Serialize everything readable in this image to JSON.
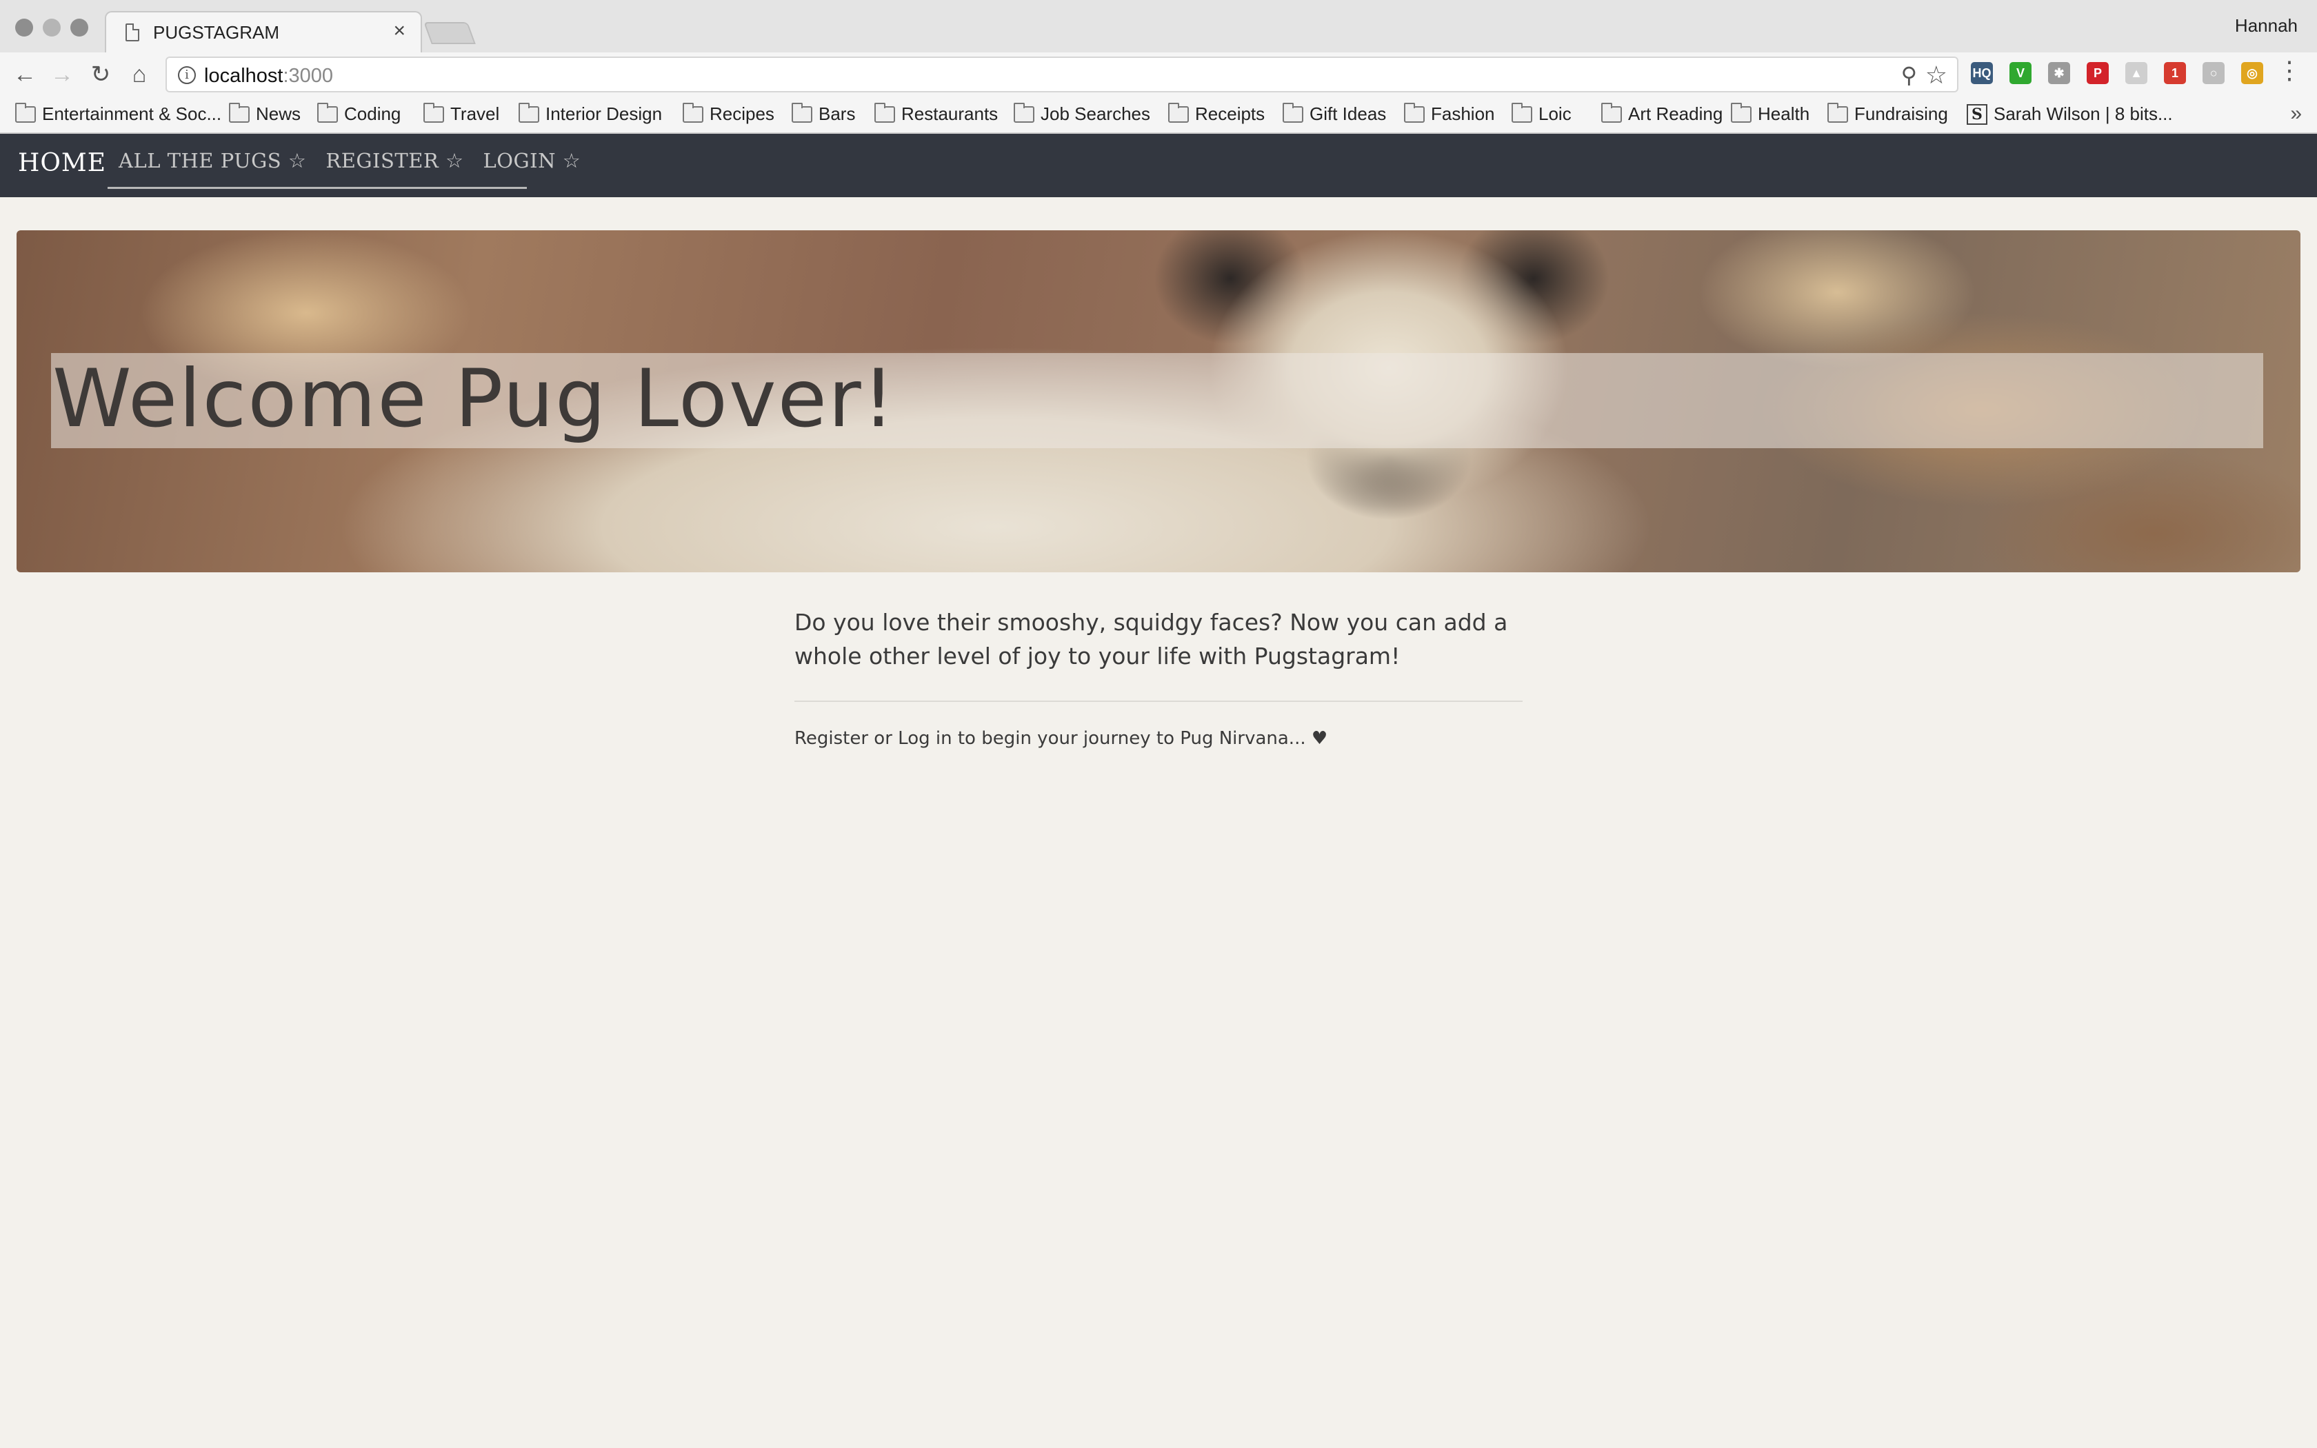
{
  "browser": {
    "tab_title": "PUGSTAGRAM",
    "tab_close": "×",
    "profile_name": "Hannah",
    "url_host": "localhost",
    "url_port": ":3000",
    "icons": {
      "back": "←",
      "forward": "→",
      "reload": "↻",
      "home": "⌂",
      "info": "i",
      "zoom": "⚲",
      "star": "☆",
      "menu": "⋮",
      "more": "»"
    },
    "extensions": [
      {
        "name": "cloudhq-extension-icon",
        "label": "HQ",
        "color": "#3b5b7d"
      },
      {
        "name": "v-extension-icon",
        "label": "V",
        "color": "#2fa82f"
      },
      {
        "name": "bug-extension-icon",
        "label": "✱",
        "color": "#9a9a9a"
      },
      {
        "name": "pinterest-extension-icon",
        "label": "P",
        "color": "#d3232a"
      },
      {
        "name": "grey-extension-icon",
        "label": "▲",
        "color": "#cfcfcf"
      },
      {
        "name": "badge-extension-icon",
        "label": "1",
        "color": "#d63b2f"
      },
      {
        "name": "circle-extension-icon",
        "label": "○",
        "color": "#bdbdbd"
      },
      {
        "name": "chrome-extension-icon",
        "label": "◎",
        "color": "#e0a51f"
      }
    ],
    "bookmarks": [
      "Entertainment & Soc...",
      "News",
      "Coding",
      "Travel",
      "Interior Design",
      "Recipes",
      "Bars",
      "Restaurants",
      "Job Searches",
      "Receipts",
      "Gift Ideas",
      "Fashion",
      "Loic",
      "Art Reading",
      "Health",
      "Fundraising"
    ],
    "bookmark_site": {
      "icon": "S",
      "label": "Sarah Wilson | 8 bits..."
    }
  },
  "site": {
    "brand": "HOME",
    "nav": [
      "ALL THE PUGS ☆",
      "REGISTER ☆",
      "LOGIN ☆"
    ],
    "hero_title": "Welcome Pug Lover!",
    "lead": "Do you love their smooshy, squidgy faces? Now you can add a whole other level of joy to your life with Pugstagram!",
    "cta": "Register or Log in to begin your journey to Pug Nirvana... ♥"
  }
}
